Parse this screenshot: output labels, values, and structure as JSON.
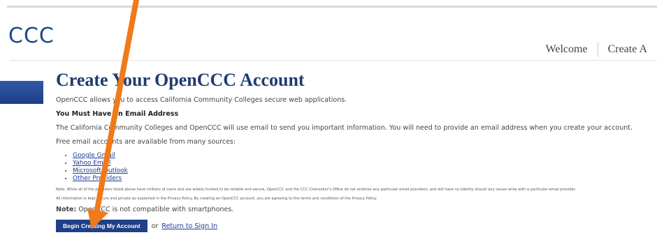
{
  "header": {
    "brand": "CCC",
    "nav": [
      "Welcome",
      "Create A"
    ]
  },
  "main": {
    "title": "Create Your OpenCCC Account",
    "intro": "OpenCCC allows you to access California Community Colleges secure web applications.",
    "must_have_email": "You Must Have an Email Address",
    "email_info": "The California Community Colleges and OpenCCC will use email to send you important information. You will need to provide an email address when you create your account.",
    "free_email": "Free email accounts are available from many sources:",
    "providers": [
      "Google Gmail",
      "Yahoo Email",
      "Microsoft Outlook",
      "Other Providers"
    ],
    "note_small_1": "Note: While all of the providers listed above have millions of users and are widely trusted to be reliable and secure, OpenCCC and the CCC Chancellor's Office do not endorse any particular email providers, and will have no liability should any issues arise with a particular email provider.",
    "note_small_2": "All information is kept secure and private as explained in the Privacy Policy. By creating an OpenCCC account, you are agreeing to the terms and conditions of the Privacy Policy.",
    "note_label": "Note:",
    "note_text": "OpenCCC is not compatible with smartphones.",
    "begin_button": "Begin Creating My Account",
    "or_text": "or",
    "return_link": "Return to Sign In"
  },
  "colors": {
    "brand": "#1a4a8a",
    "button": "#1f3f86",
    "arrow": "#f07a1a"
  }
}
